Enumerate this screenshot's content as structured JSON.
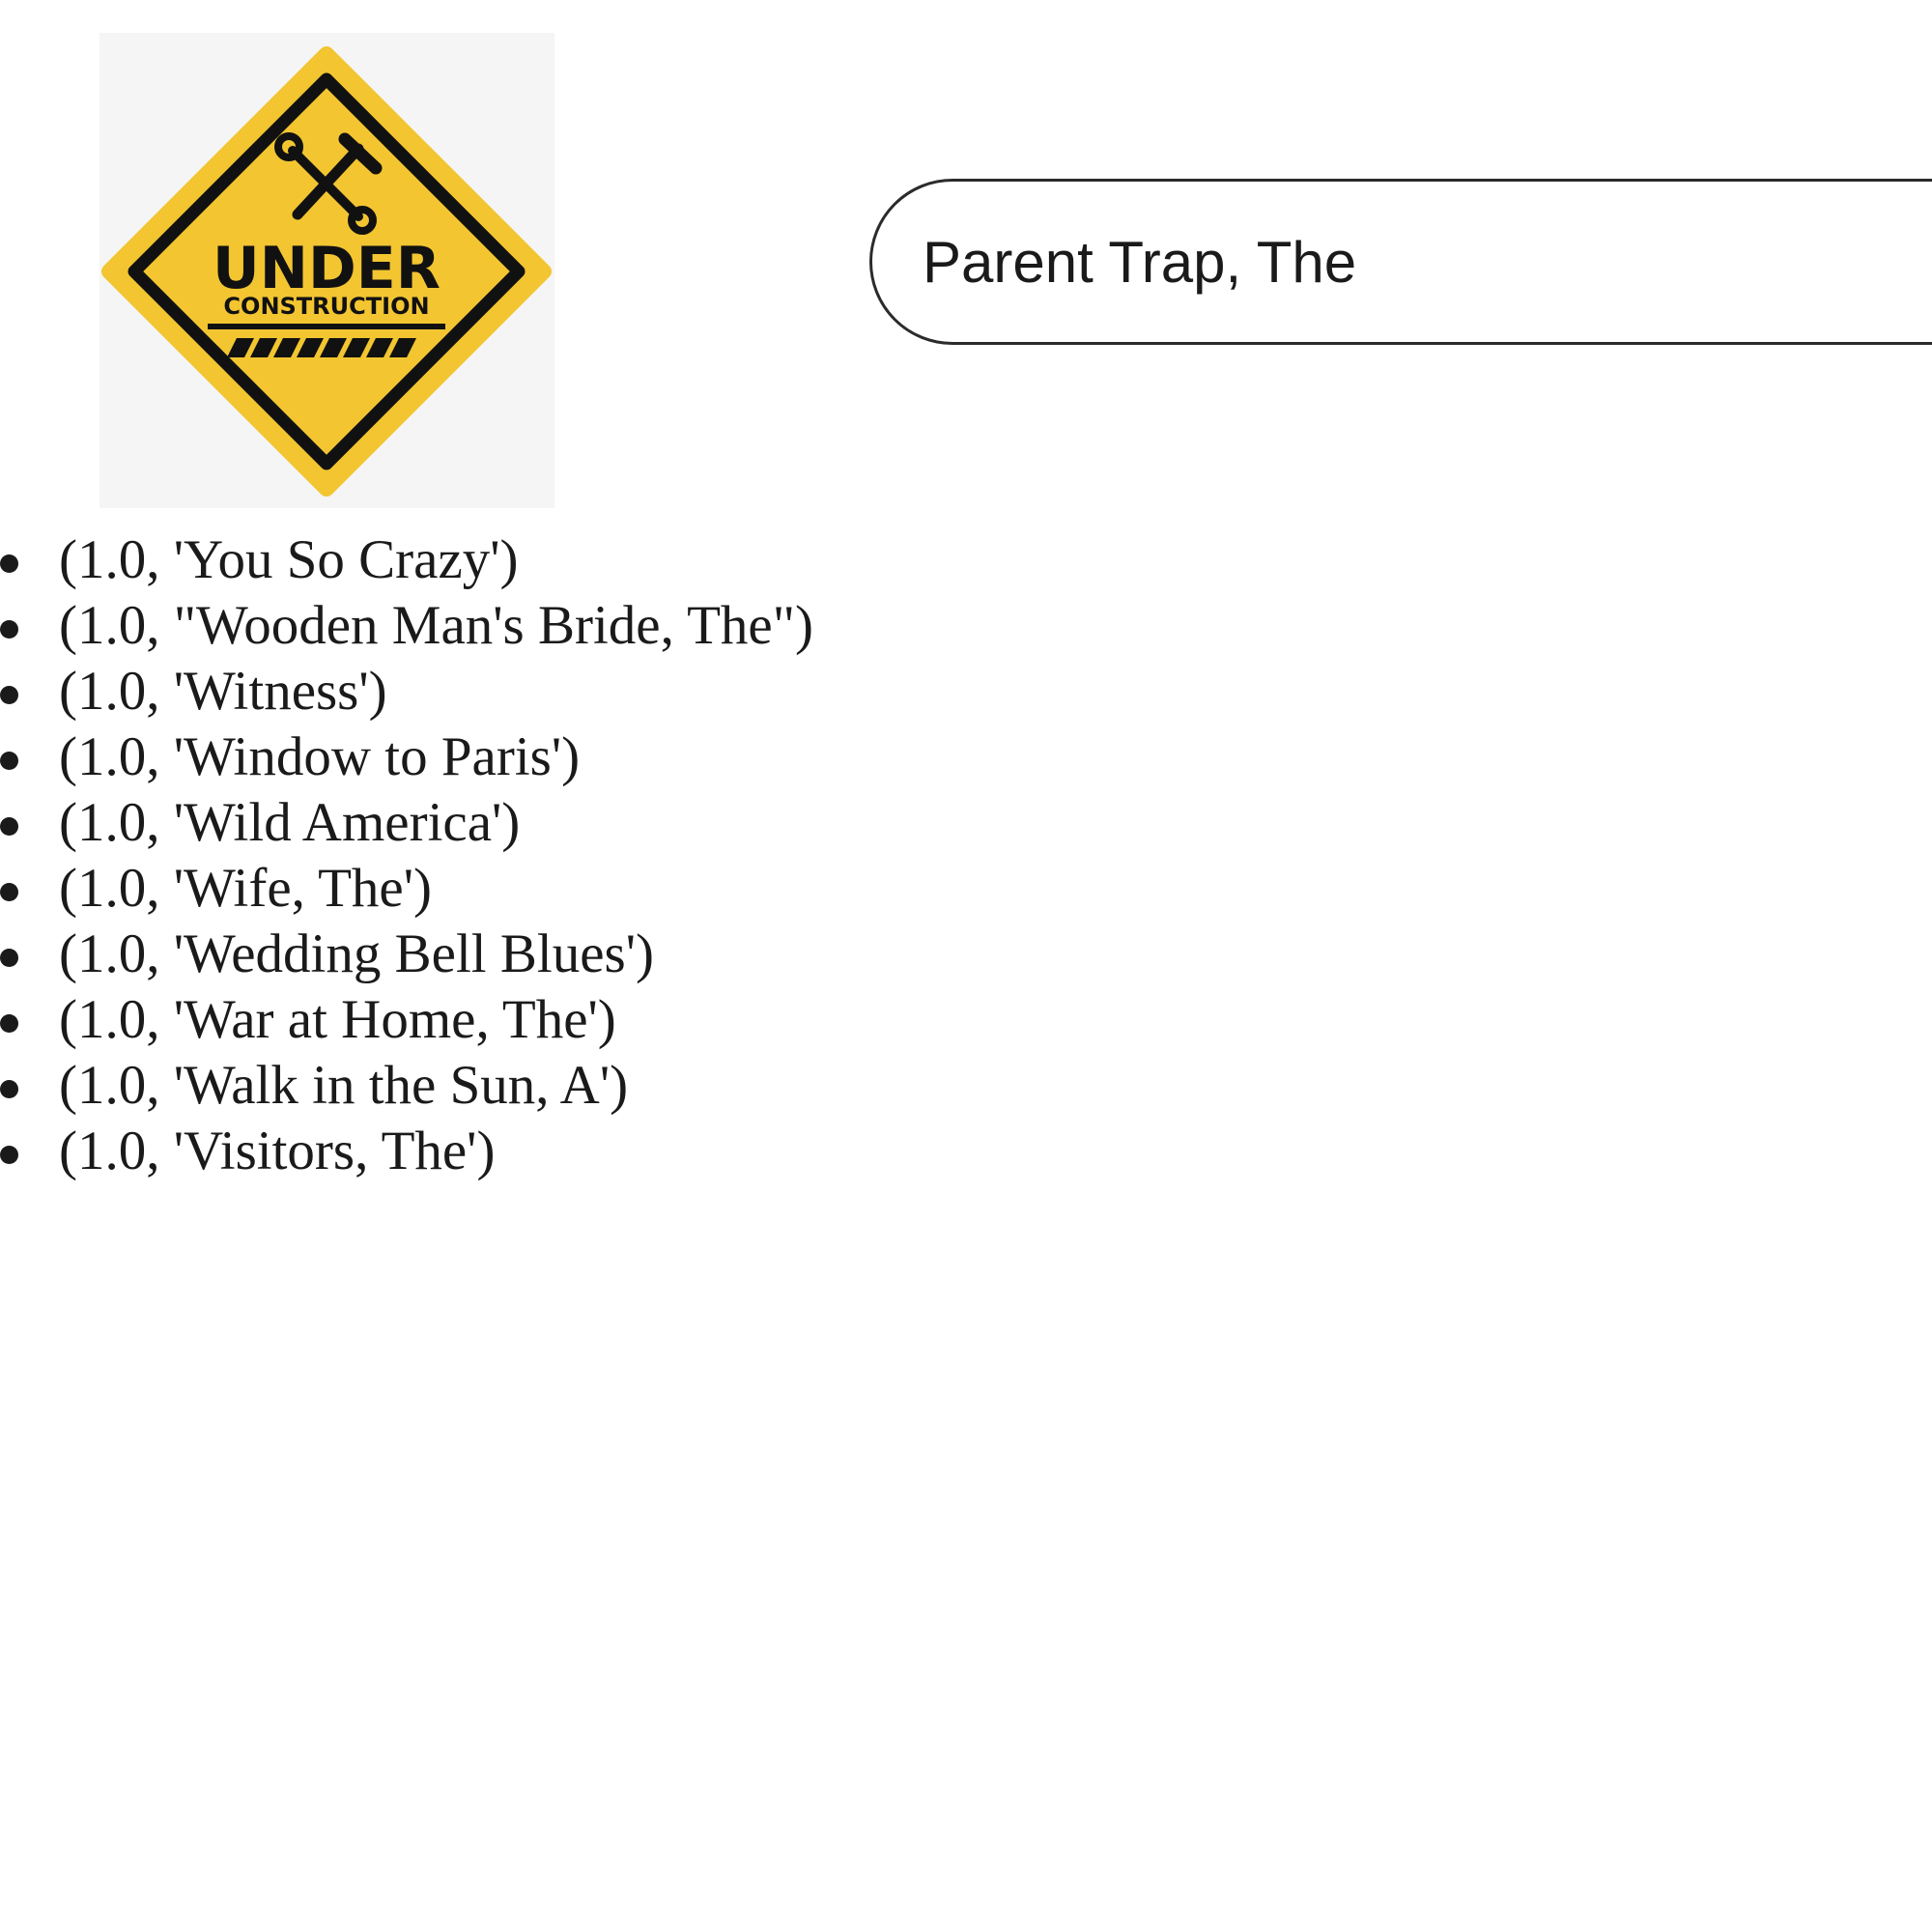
{
  "logo": {
    "icon": "under-construction-sign",
    "line1": "UNDER",
    "line2": "CONSTRUCTION",
    "colors": {
      "sign_yellow": "#F2C531",
      "sign_black": "#111111",
      "background": "#F5F5F5"
    }
  },
  "search": {
    "value": "Parent Trap, The"
  },
  "results": [
    {
      "label": "(1.0, 'You So Crazy')"
    },
    {
      "label": "(1.0, \"Wooden Man's Bride, The\")"
    },
    {
      "label": "(1.0, 'Witness')"
    },
    {
      "label": "(1.0, 'Window to Paris')"
    },
    {
      "label": "(1.0, 'Wild America')"
    },
    {
      "label": "(1.0, 'Wife, The')"
    },
    {
      "label": "(1.0, 'Wedding Bell Blues')"
    },
    {
      "label": "(1.0, 'War at Home, The')"
    },
    {
      "label": "(1.0, 'Walk in the Sun, A')"
    },
    {
      "label": "(1.0, 'Visitors, The')"
    }
  ]
}
